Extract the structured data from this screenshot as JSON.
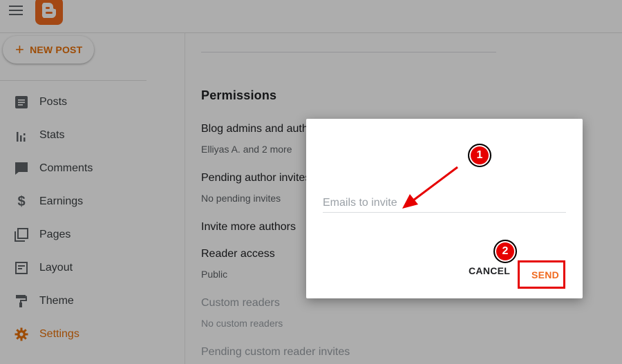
{
  "header": {
    "menu_icon": "hamburger-menu-icon",
    "logo_icon": "blogger-logo-icon"
  },
  "sidebar": {
    "new_post_label": "NEW POST",
    "items": [
      {
        "label": "Posts",
        "icon": "posts-icon",
        "active": false
      },
      {
        "label": "Stats",
        "icon": "stats-icon",
        "active": false
      },
      {
        "label": "Comments",
        "icon": "comments-icon",
        "active": false
      },
      {
        "label": "Earnings",
        "icon": "dollar-icon",
        "active": false
      },
      {
        "label": "Pages",
        "icon": "pages-icon",
        "active": false
      },
      {
        "label": "Layout",
        "icon": "layout-icon",
        "active": false
      },
      {
        "label": "Theme",
        "icon": "paint-roller-icon",
        "active": false
      },
      {
        "label": "Settings",
        "icon": "gear-icon",
        "active": true
      }
    ]
  },
  "permissions": {
    "title": "Permissions",
    "admins_title": "Blog admins and authors",
    "admins_sub": "Elliyas A. and 2 more",
    "pending_title": "Pending author invites",
    "pending_sub": "No pending invites",
    "invite_title": "Invite more authors",
    "reader_title": "Reader access",
    "reader_sub": "Public",
    "custom_title": "Custom readers",
    "custom_sub": "No custom readers",
    "pending_custom_title": "Pending custom reader invites"
  },
  "dialog": {
    "email_placeholder": "Emails to invite",
    "email_value": "",
    "cancel_label": "CANCEL",
    "send_label": "SEND"
  },
  "annotations": {
    "badge_1": "1",
    "badge_2": "2"
  },
  "colors": {
    "accent": "#e8710a",
    "annotation_red": "#e60000"
  }
}
